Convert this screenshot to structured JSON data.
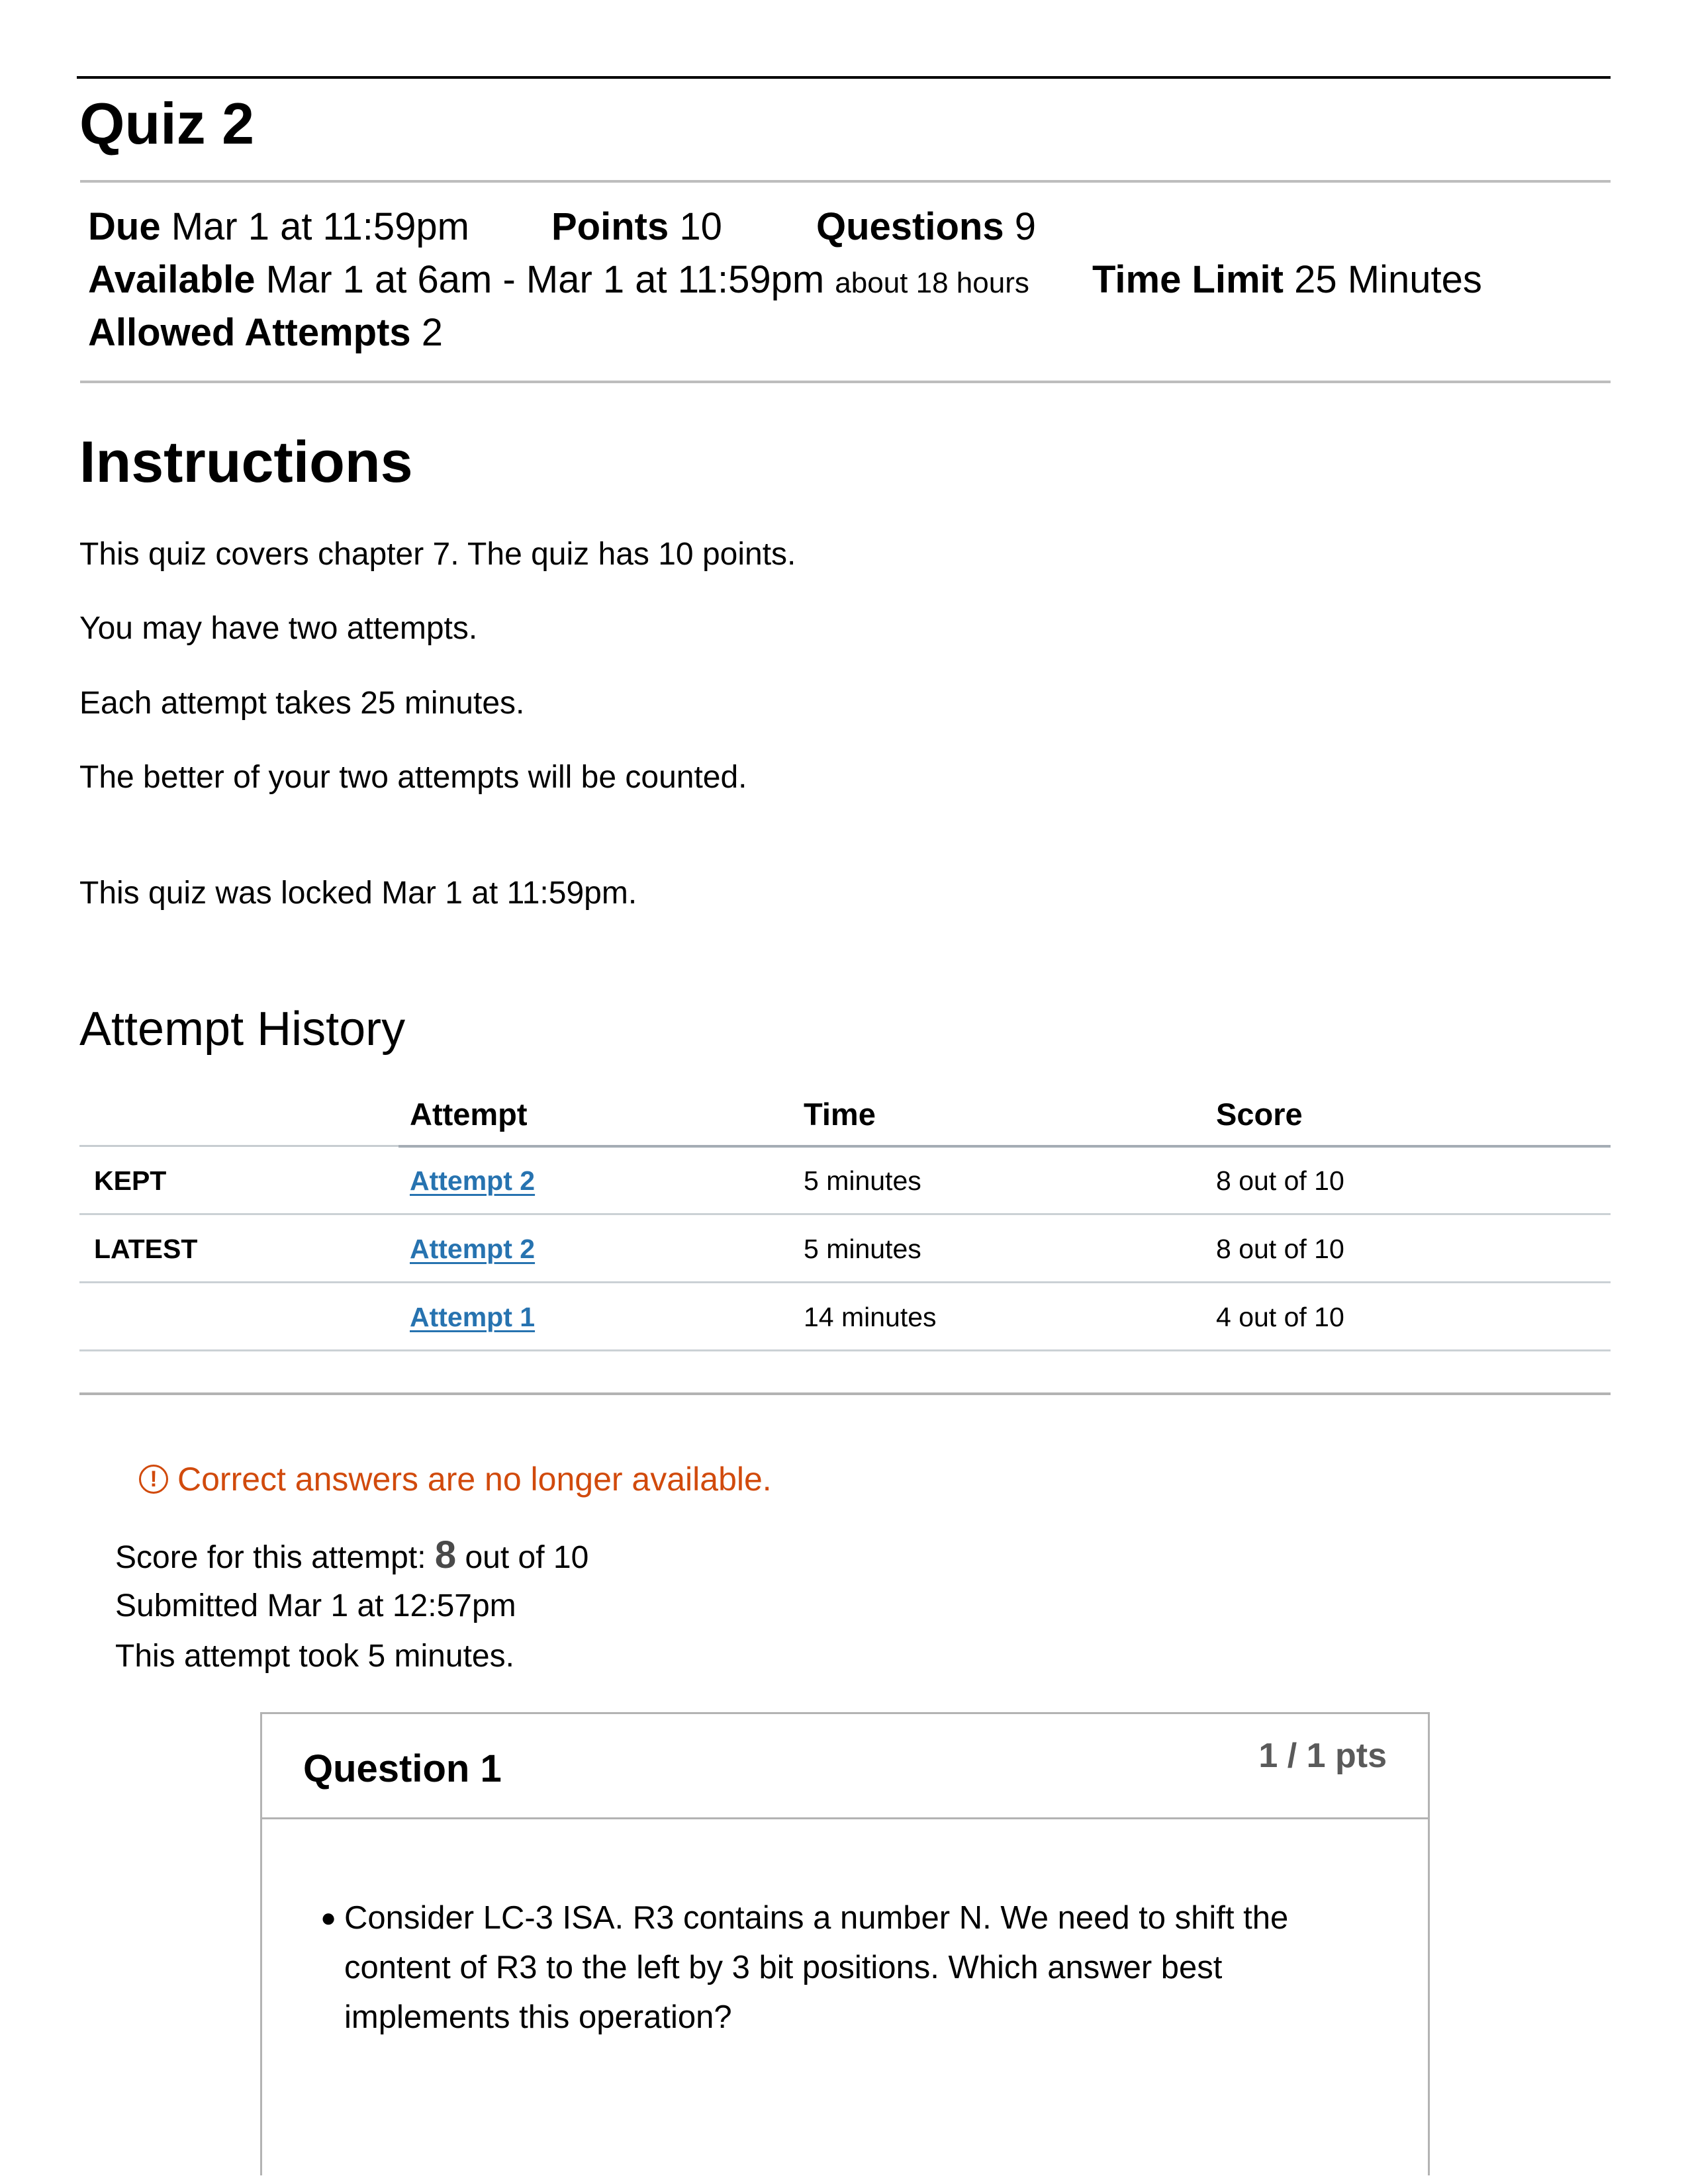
{
  "quiz": {
    "title": "Quiz 2",
    "details": {
      "due_label": "Due",
      "due_value": "Mar 1 at 11:59pm",
      "points_label": "Points",
      "points_value": "10",
      "questions_label": "Questions",
      "questions_value": "9",
      "available_label": "Available",
      "available_value": "Mar 1 at 6am - Mar 1 at 11:59pm",
      "available_duration": "about 18 hours",
      "time_limit_label": "Time Limit",
      "time_limit_value": "25 Minutes",
      "allowed_attempts_label": "Allowed Attempts",
      "allowed_attempts_value": "2"
    }
  },
  "instructions": {
    "heading": "Instructions",
    "paragraphs": [
      "This quiz covers chapter 7. The quiz has 10 points.",
      "You may have two attempts.",
      "Each attempt takes 25 minutes.",
      "The better of your two attempts will be counted."
    ],
    "locked_notice": "This quiz was locked Mar 1 at 11:59pm."
  },
  "attempt_history": {
    "heading": "Attempt History",
    "columns": [
      "",
      "Attempt",
      "Time",
      "Score"
    ],
    "rows": [
      {
        "tag": "KEPT",
        "attempt": "Attempt 2",
        "time": "5 minutes",
        "score": "8 out of 10"
      },
      {
        "tag": "LATEST",
        "attempt": "Attempt 2",
        "time": "5 minutes",
        "score": "8 out of 10"
      },
      {
        "tag": "",
        "attempt": "Attempt 1",
        "time": "14 minutes",
        "score": "4 out of 10"
      }
    ]
  },
  "result": {
    "warning_icon": "exclamation-circle-icon",
    "warning_text": "Correct answers are no longer available.",
    "score_label": "Score for this attempt:",
    "score_value": "8",
    "score_suffix": "out of 10",
    "submitted": "Submitted Mar 1 at 12:57pm",
    "duration": "This attempt took 5 minutes."
  },
  "questions": [
    {
      "title": "Question 1",
      "points": "1 / 1 pts",
      "bullet_text": "Consider LC-3 ISA. R3 contains a number N. We need to shift the content of R3 to the left by 3 bit positions. Which answer best implements this operation?"
    }
  ],
  "colors": {
    "link": "#2773b0",
    "warning": "#d14a0c",
    "points_text": "#5a5a5a"
  }
}
